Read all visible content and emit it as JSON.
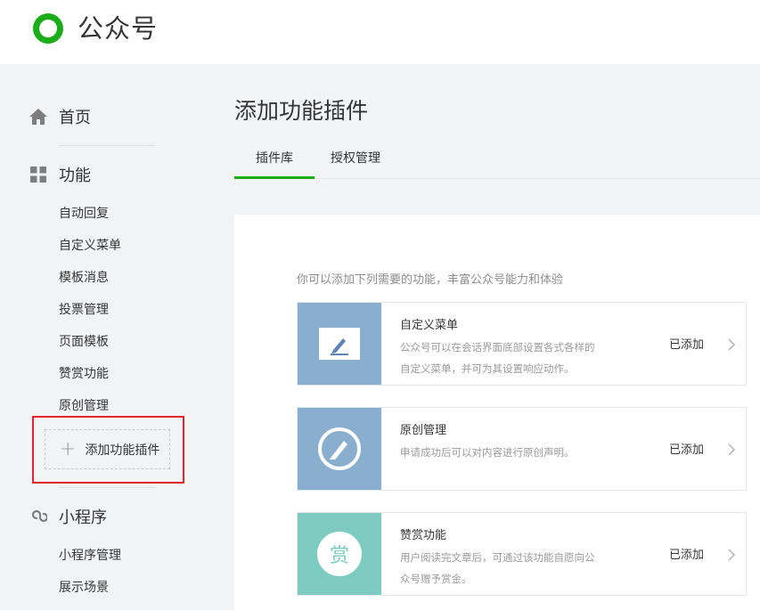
{
  "header": {
    "brand": "公众号",
    "logo_icon": "wechat-mp-logo-icon",
    "logo_color": "#1aad19"
  },
  "sidebar": {
    "home": {
      "label": "首页",
      "icon": "home-icon"
    },
    "features": {
      "label": "功能",
      "icon": "grid-icon",
      "items": [
        "自动回复",
        "自定义菜单",
        "模板消息",
        "投票管理",
        "页面模板",
        "赞赏功能",
        "原创管理"
      ]
    },
    "add_plugin": {
      "label": "添加功能插件",
      "icon": "plus-icon"
    },
    "miniprogram": {
      "label": "小程序",
      "icon": "link-icon",
      "items": [
        "小程序管理",
        "展示场景"
      ]
    }
  },
  "main": {
    "title": "添加功能插件",
    "tabs": [
      {
        "label": "插件库",
        "active": true
      },
      {
        "label": "授权管理",
        "active": false
      }
    ],
    "intro": "你可以添加下列需要的功能，丰富公众号能力和体验",
    "cards": [
      {
        "name": "自定义菜单",
        "desc_lines": [
          "公众号可以在会话界面底部设置各式各样的",
          "自定义菜单，并可为其设置响应动作。"
        ],
        "status": "已添加",
        "icon": "menu-edit-icon",
        "color": "#8aafce"
      },
      {
        "name": "原创管理",
        "desc_lines": [
          "申请成功后可以对内容进行原创声明。"
        ],
        "status": "已添加",
        "icon": "pen-circle-icon",
        "color": "#8aafce"
      },
      {
        "name": "赞赏功能",
        "desc_lines": [
          "用户阅读完文章后，可通过该功能自愿向公",
          "众号赠予赏金。"
        ],
        "status": "已添加",
        "icon": "reward-icon",
        "icon_char": "赏",
        "color": "#7ecbc1"
      }
    ]
  }
}
